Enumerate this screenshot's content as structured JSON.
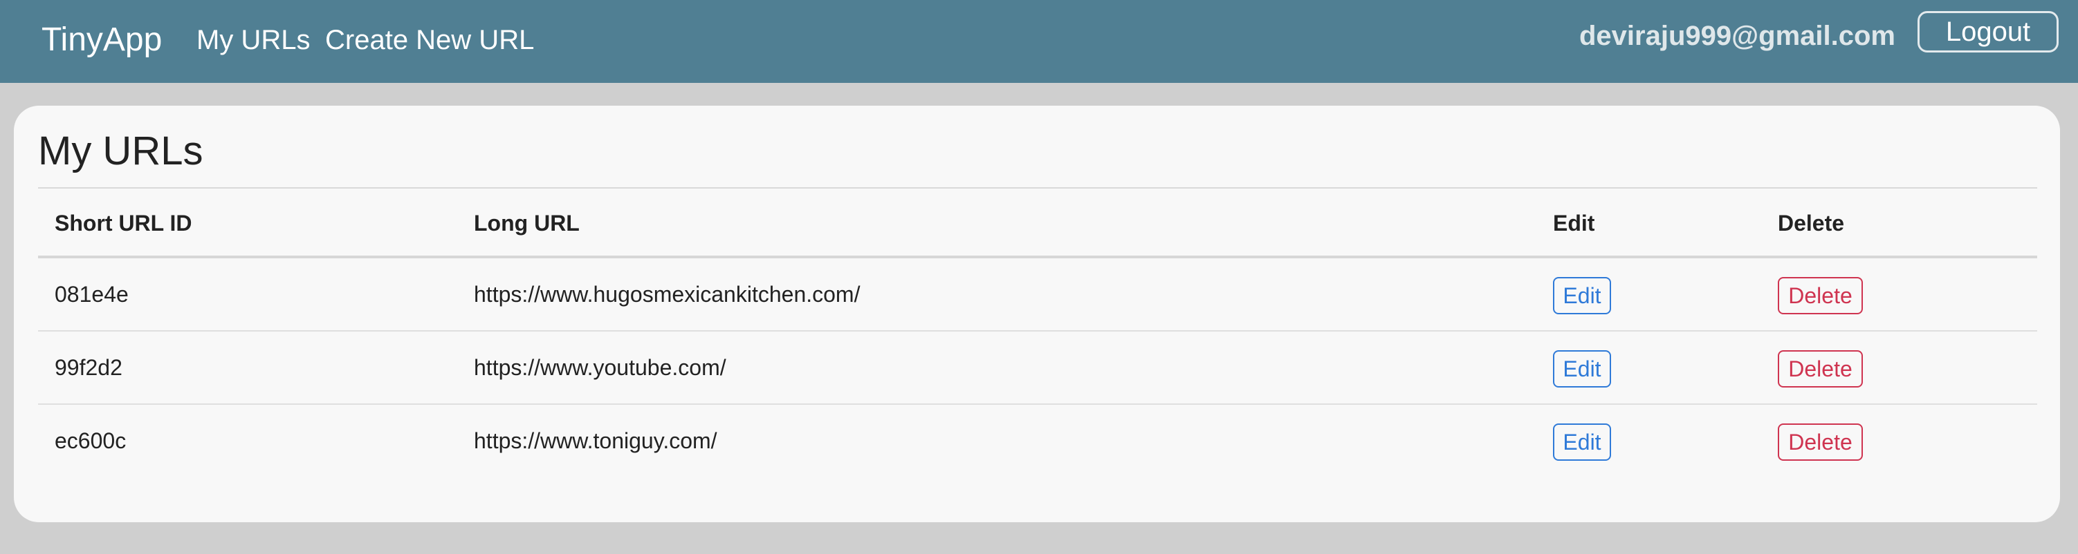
{
  "header": {
    "brand": "TinyApp",
    "nav": [
      {
        "label": "My URLs"
      },
      {
        "label": "Create New URL"
      }
    ],
    "user_email": "deviraju999@gmail.com",
    "logout_label": "Logout",
    "background_color": "#507f93"
  },
  "main": {
    "title": "My URLs",
    "table": {
      "columns": [
        "Short URL ID",
        "Long URL",
        "Edit",
        "Delete"
      ],
      "rows": [
        {
          "short_id": "081e4e",
          "long_url": "https://www.hugosmexicankitchen.com/",
          "edit_label": "Edit",
          "delete_label": "Delete"
        },
        {
          "short_id": "99f2d2",
          "long_url": "https://www.youtube.com/",
          "edit_label": "Edit",
          "delete_label": "Delete"
        },
        {
          "short_id": "ec600c",
          "long_url": "https://www.toniguy.com/",
          "edit_label": "Edit",
          "delete_label": "Delete"
        }
      ]
    },
    "colors": {
      "edit_button": "#2f7ad8",
      "delete_button": "#cf3450"
    }
  }
}
